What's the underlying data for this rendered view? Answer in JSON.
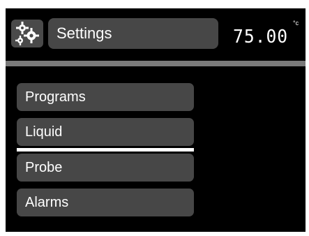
{
  "header": {
    "title": "Settings",
    "app_icon": "gear-icon",
    "temperature": {
      "value": "75.00",
      "unit": "°c"
    }
  },
  "menu": {
    "items": [
      {
        "label": "Programs"
      },
      {
        "label": "Liquid"
      },
      {
        "label": "Probe"
      },
      {
        "label": "Alarms"
      }
    ]
  },
  "colors": {
    "background": "#000000",
    "button": "#474747",
    "divider": "#7a7a7a",
    "text": "#ffffff",
    "selection": "#ffffff"
  }
}
